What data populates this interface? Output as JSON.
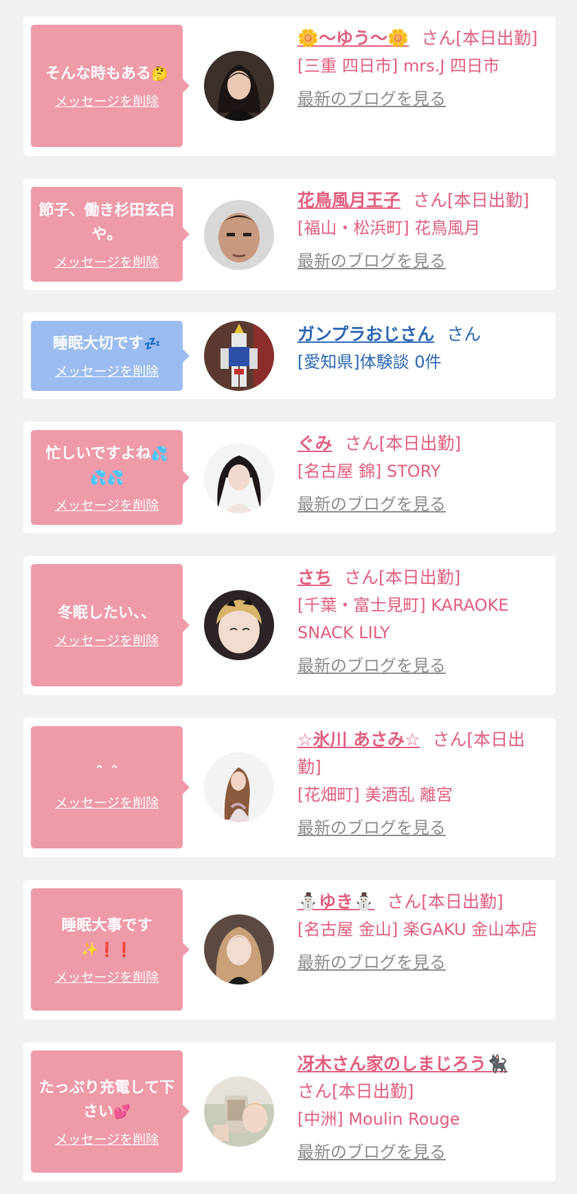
{
  "colors": {
    "page_background": "#f1f1f2",
    "card_background": "#ffffff",
    "bubble_pink": "#ee9aa8",
    "bubble_blue": "#9bbcf1",
    "name_pink": "#e25d7d",
    "name_blue": "#2a65b3",
    "blog_link_gray": "#8b8b8b"
  },
  "delete_label": "メッセージを削除",
  "blog_label": "最新のブログを見る",
  "entries": [
    {
      "message": "そんな時もある",
      "message_emoji": "🤔",
      "name": "🌼〜ゆう〜🌼",
      "suffix": "さん[本日出勤]",
      "shop": "[三重 四日市] mrs.J 四日市",
      "avatar": "dark-hair-woman"
    },
    {
      "message": "節子、働き杉田玄白や。",
      "message_emoji": "",
      "name": "花鳥風月王子",
      "suffix": "さん[本日出勤]",
      "shop": "[福山・松浜町] 花鳥風月",
      "avatar": "man-face"
    },
    {
      "message": "睡眠大切です",
      "message_emoji": "💤",
      "name": "ガンプラおじさん",
      "suffix": "さん",
      "shop": "[愛知県]体験談 0件",
      "avatar": "robot-model"
    },
    {
      "message": "忙しいですよね",
      "message_emoji": "💦💦💦",
      "name": "ぐみ",
      "suffix": "さん[本日出勤]",
      "shop": "[名古屋 錦] STORY",
      "avatar": "twin-tail-woman"
    },
    {
      "message": "冬眠したい、、",
      "message_emoji": "",
      "name": "さち",
      "suffix": "さん[本日出勤]",
      "shop": "[千葉・富士見町] KARAOKE SNACK LILY",
      "avatar": "blonde-woman-butterflies"
    },
    {
      "message": "＾＾",
      "message_emoji": "",
      "name": "☆氷川 あさみ☆",
      "suffix": "さん[本日出勤]",
      "shop": "[花畑町] 美酒乱 離宮",
      "avatar": "woman-white-background"
    },
    {
      "message": "睡眠大事です",
      "message_emoji": "✨❗️❗️",
      "name": "⛄ゆき⛄",
      "suffix": "さん[本日出勤]",
      "shop": "[名古屋 金山] 楽GAKU 金山本店",
      "avatar": "light-hair-woman"
    },
    {
      "message": "たっぷり充電して下さい",
      "message_emoji": "💕",
      "name": "冴木さん家のしまじろう🐈‍⬛",
      "suffix": "さん[本日出勤]",
      "shop": "[中洲] Moulin Rouge",
      "avatar": "woman-taking-selfie"
    }
  ]
}
